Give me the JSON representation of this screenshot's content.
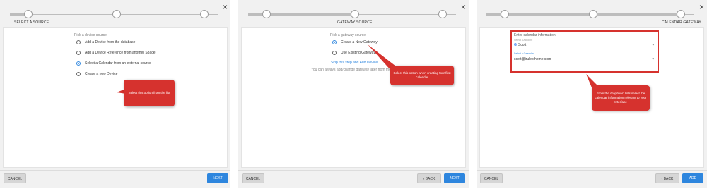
{
  "panels": [
    {
      "step_title": "SELECT A SOURCE",
      "close_icon": "×",
      "prompt": "Pick a device source",
      "options": [
        "Add a Device from the database",
        "Add a Device Reference from another Space",
        "Select a Calendar from an external source",
        "Create a new Device"
      ],
      "callout": "Select this option from the list",
      "cancel": "CANCEL",
      "next": "NEXT"
    },
    {
      "step_title": "GATEWAY SOURCE",
      "close_icon": "×",
      "prompt": "Pick a gateway source",
      "options": [
        "Create a New Gateway",
        "Use Existing Gateway"
      ],
      "link": "Skip this step and Add Device",
      "info": "You can always add/change gateway later from the device",
      "callout": "Select this option when creating tour first calendar",
      "cancel": "CANCEL",
      "back": "BACK",
      "next": "NEXT"
    },
    {
      "step_title": "CALENDAR GATEWAY",
      "close_icon": "×",
      "prompt": "Enter calendar information",
      "field1_label": "Select a Account",
      "field1_icon": "G",
      "field1_value": "Scott",
      "field2_label": "Select a Calendar",
      "field2_value": "scott@irulestheme.com",
      "callout": "From the dropdown lists select the calendar information relevant to your Interface",
      "cancel": "CANCEL",
      "back": "BACK",
      "add": "ADD"
    }
  ],
  "colors": {
    "accent": "#2e86de",
    "callout": "#d6322e"
  }
}
